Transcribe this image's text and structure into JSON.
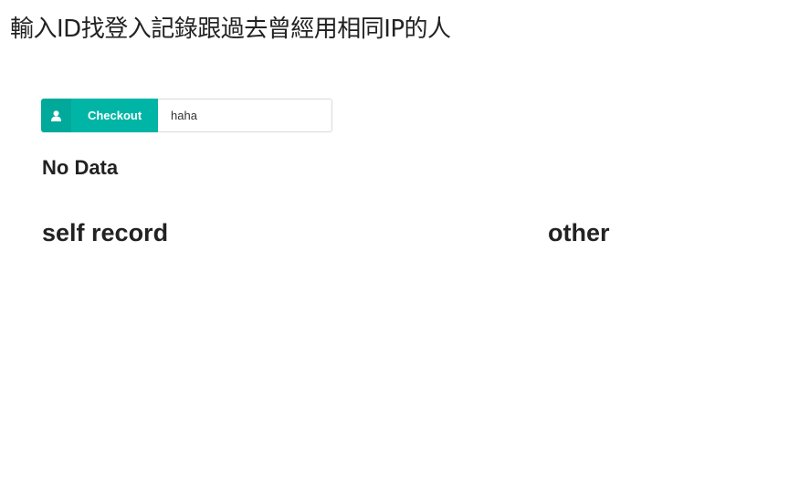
{
  "page": {
    "title": "輸入ID找登入記錄跟過去曾經用相同IP的人"
  },
  "search": {
    "icon": "user-icon",
    "button_label": "Checkout",
    "input_value": "haha"
  },
  "result": {
    "status_text": "No Data"
  },
  "sections": {
    "self_record_label": "self record",
    "other_label": "other"
  },
  "colors": {
    "accent": "#00b5a5",
    "accent_dark": "#00a99a"
  }
}
